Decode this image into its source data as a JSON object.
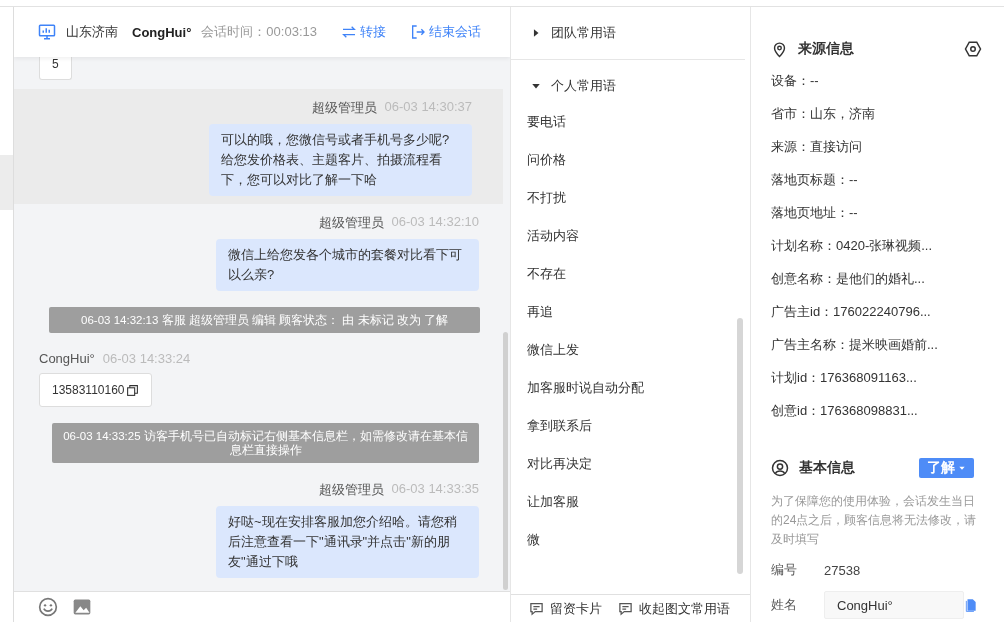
{
  "header": {
    "location": "山东济南",
    "visitor": "CongHui°",
    "duration_label": "会话时间：",
    "duration": "00:03:13",
    "transfer": "转接",
    "end": "结束会话"
  },
  "messages": [
    {
      "kind": "card",
      "text": "5"
    },
    {
      "kind": "agent",
      "highlighted": true,
      "sender": "超级管理员",
      "time": "06-03 14:30:37",
      "text": "可以的哦，您微信号或者手机号多少呢?给您发价格表、主题客片、拍摄流程看下，您可以对比了解一下哈"
    },
    {
      "kind": "agent",
      "highlighted": false,
      "sender": "超级管理员",
      "time": "06-03 14:32:10",
      "text": "微信上给您发各个城市的套餐对比看下可以么亲?"
    },
    {
      "kind": "system",
      "text": "06-03 14:32:13 客服 超级管理员 编辑 顾客状态： 由 未标记 改为 了解"
    },
    {
      "kind": "visitor",
      "highlighted": false,
      "sender": "CongHui°",
      "time": "06-03 14:33:24",
      "text": "13583110160"
    },
    {
      "kind": "system",
      "text": "06-03 14:33:25 访客手机号已自动标记右侧基本信息栏，如需修改请在基本信息栏直接操作"
    },
    {
      "kind": "agent",
      "highlighted": false,
      "sender": "超级管理员",
      "time": "06-03 14:33:35",
      "text": "好哒~现在安排客服加您介绍哈。请您稍后注意查看一下\"通讯录\"并点击\"新的朋友\"通过下哦"
    }
  ],
  "phrases": {
    "groups": [
      {
        "label": "团队常用语",
        "expanded": false
      },
      {
        "label": "个人常用语",
        "expanded": true
      }
    ],
    "items": [
      "要电话",
      "问价格",
      "不打扰",
      "活动内容",
      "不存在",
      "再追",
      "微信上发",
      "加客服时说自动分配",
      "拿到联系后",
      "对比再决定",
      "让加客服",
      "微"
    ],
    "footer": [
      "留资卡片",
      "收起图文常用语"
    ]
  },
  "source_info": {
    "title": "来源信息",
    "fields": [
      "设备：--",
      "省市：山东，济南",
      "来源：直接访问",
      "落地页标题：--",
      "落地页地址：--",
      "计划名称：0420-张琳视频...",
      "创意名称：是他们的婚礼...",
      "广告主id：176022240796...",
      "广告主名称：提米映画婚前...",
      "计划id：176368091163...",
      "创意id：176368098831..."
    ]
  },
  "basic_info": {
    "title": "基本信息",
    "status": "了解",
    "notice": "为了保障您的使用体验，会话发生当日的24点之后，顾客信息将无法修改，请及时填写",
    "fields": [
      {
        "kind": "text",
        "label": "编号",
        "value": "27538"
      },
      {
        "kind": "input",
        "label": "姓名",
        "value": "CongHui°"
      }
    ]
  }
}
